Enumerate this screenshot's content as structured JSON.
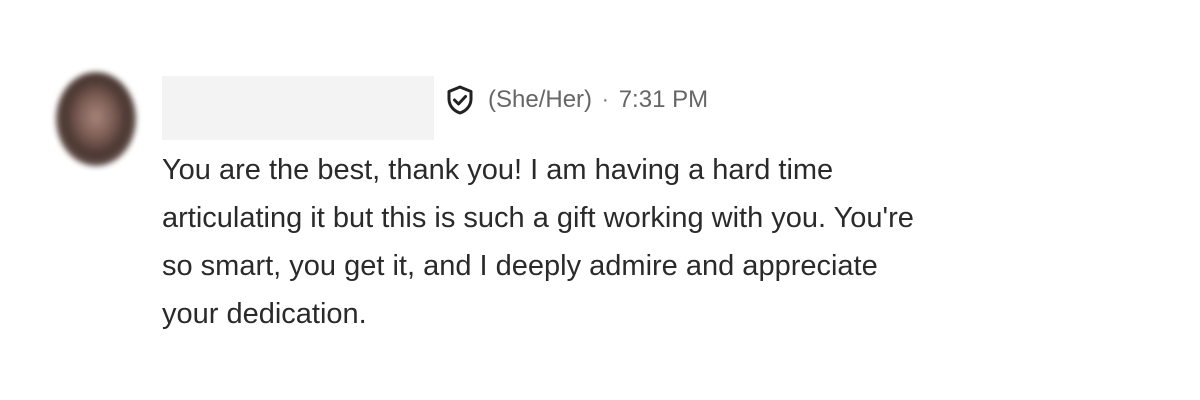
{
  "message": {
    "pronouns": "(She/Her)",
    "separator": "·",
    "timestamp": "7:31 PM",
    "verified_icon": "shield-check-icon",
    "body_lines": [
      "You are the best, thank you! I am having a hard time",
      "articulating it but this is such a gift working with you. You're",
      "so smart, you get it, and I deeply admire and appreciate",
      "your dedication."
    ]
  },
  "colors": {
    "meta_text": "#666666",
    "body_text": "#2a2a2a",
    "redaction": "#f3f3f3"
  }
}
